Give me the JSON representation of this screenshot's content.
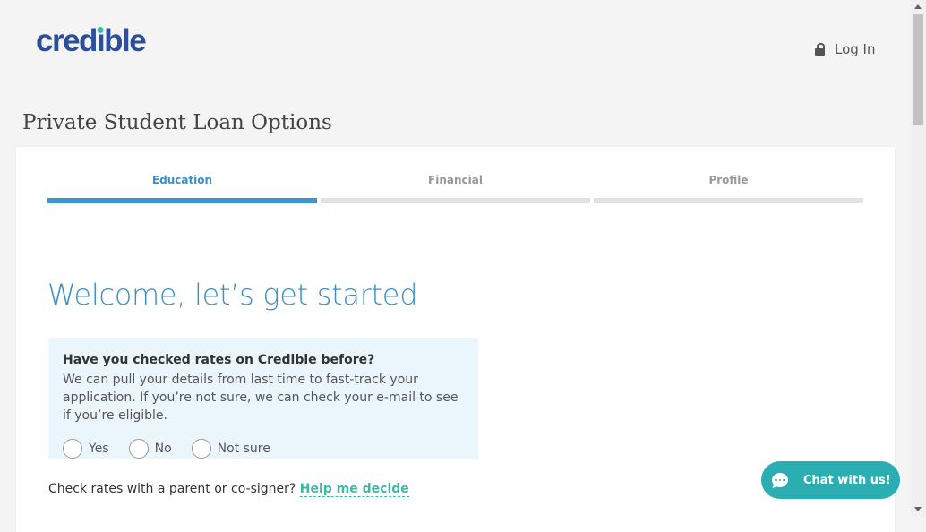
{
  "header": {
    "logo_pre": "cred",
    "logo_i": "ı",
    "logo_post": "ble",
    "login_label": "Log In"
  },
  "page_title": "Private Student Loan Options",
  "steps": [
    {
      "label": "Education",
      "active": true
    },
    {
      "label": "Financial",
      "active": false
    },
    {
      "label": "Profile",
      "active": false
    }
  ],
  "welcome": "Welcome, let’s get started",
  "question": {
    "title": "Have you checked rates on Credible before?",
    "description": "We can pull your details from last time to fast-track your application. If you’re not sure, we can check your e-mail to see if you’re eligible.",
    "options": [
      "Yes",
      "No",
      "Not sure"
    ]
  },
  "cosigner": {
    "text": "Check rates with a parent or co-signer?",
    "link": "Help me decide"
  },
  "chat": {
    "label": "Chat with us!",
    "icon": "chat-bubble-icon"
  },
  "colors": {
    "brand": "#2d4f9a",
    "accent": "#3b97d3",
    "teal": "#3cb9a6",
    "chat": "#2aaeb2"
  }
}
